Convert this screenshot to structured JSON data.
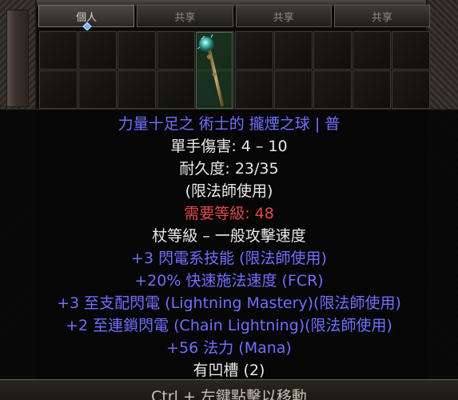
{
  "stash": {
    "tabs": [
      {
        "label": "個人",
        "active": true
      },
      {
        "label": "共享",
        "active": false
      },
      {
        "label": "共享",
        "active": false
      },
      {
        "label": "共享",
        "active": false
      }
    ],
    "columns": 10,
    "rows": 2,
    "item_icon": "staff-orb-icon"
  },
  "tooltip": {
    "name": "力量十足之 術士的 攏煙之球 | 普",
    "lines": [
      {
        "text": "單手傷害:  4 – 10",
        "color": "#e8e8e8"
      },
      {
        "text": "耐久度:  23/35",
        "color": "#e8e8e8"
      },
      {
        "text": "(限法師使用)",
        "color": "#e8e8e8"
      },
      {
        "text": "需要等級:  48",
        "color": "#e04848"
      },
      {
        "text": "杖等級 – 一般攻擊速度",
        "color": "#e8e8e8"
      },
      {
        "text": "+3 閃電系技能 (限法師使用)",
        "color": "#6f6fff"
      },
      {
        "text": "+20% 快速施法速度 (FCR)",
        "color": "#6f6fff"
      },
      {
        "text": "+3 至支配閃電 (Lightning Mastery)(限法師使用)",
        "color": "#6f6fff"
      },
      {
        "text": "+2 至連鎖閃電 (Chain Lightning)(限法師使用)",
        "color": "#6f6fff"
      },
      {
        "text": "+56 法力 (Mana)",
        "color": "#6f6fff"
      },
      {
        "text": "有凹槽 (2)",
        "color": "#e8e8e8"
      }
    ],
    "name_color": "#6f6fff"
  },
  "footer": {
    "hint": "Ctrl + 左鍵點擊以移動"
  }
}
